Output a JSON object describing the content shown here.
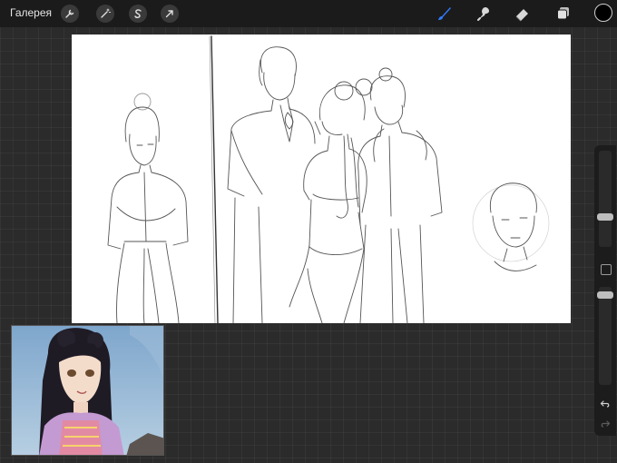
{
  "topbar": {
    "gallery_label": "Галерея",
    "left_tools": [
      {
        "icon": "wrench-icon"
      },
      {
        "icon": "magic-wand-icon"
      },
      {
        "icon": "selection-s-icon"
      },
      {
        "icon": "transform-arrow-icon"
      }
    ],
    "right_tools": [
      {
        "icon": "brush-icon",
        "active": true,
        "color": "#2f7bff"
      },
      {
        "icon": "smudge-icon"
      },
      {
        "icon": "eraser-icon"
      },
      {
        "icon": "layers-icon"
      }
    ],
    "current_color": "#000000"
  },
  "sidebar": {
    "brush_size_level": 0.3,
    "opacity_level": 0.95,
    "modify_button_icon": "square-icon",
    "undo_icon": "undo-arrow-icon",
    "redo_icon": "redo-arrow-icon"
  },
  "reference_window": {
    "sky_color": "#8fb4d6",
    "hair_color": "#1c1a24",
    "robe_color": "#b88ac9"
  }
}
